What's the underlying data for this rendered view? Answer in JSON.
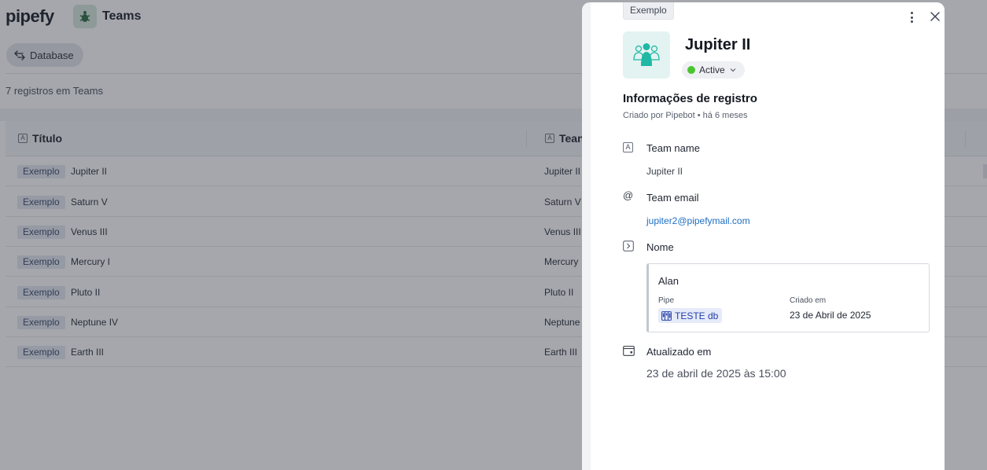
{
  "app": {
    "logo": "pipefy",
    "database_title": "Teams",
    "database_button_label": "Database",
    "records_count": "7 registros em Teams"
  },
  "table": {
    "columns": [
      "Título",
      "Tean"
    ],
    "rows": [
      {
        "tag": "Exemplo",
        "title": "Jupiter II",
        "team": "Jupiter II"
      },
      {
        "tag": "Exemplo",
        "title": "Saturn V",
        "team": "Saturn V"
      },
      {
        "tag": "Exemplo",
        "title": "Venus III",
        "team": "Venus III"
      },
      {
        "tag": "Exemplo",
        "title": "Mercury I",
        "team": "Mercury"
      },
      {
        "tag": "Exemplo",
        "title": "Pluto II",
        "team": "Pluto II"
      },
      {
        "tag": "Exemplo",
        "title": "Neptune IV",
        "team": "Neptune"
      },
      {
        "tag": "Exemplo",
        "title": "Earth III",
        "team": "Earth III"
      }
    ]
  },
  "panel": {
    "badge": "Exemplo",
    "title": "Jupiter II",
    "status": "Active",
    "status_color": "#49c530",
    "section_title": "Informações de registro",
    "section_subtitle": "Criado por Pipebot • há 6 meses",
    "fields": {
      "team_name": {
        "label": "Team name",
        "value": "Jupiter II",
        "icon": "text-field-icon"
      },
      "team_email": {
        "label": "Team email",
        "value": "jupiter2@pipefymail.com",
        "icon": "at-sign-icon"
      },
      "nome": {
        "label": "Nome",
        "icon": "connection-field-icon",
        "card": {
          "name": "Alan",
          "pipe_label": "Pipe",
          "pipe_value": "TESTE db",
          "created_label": "Criado em",
          "created_value": "23 de Abril de 2025"
        }
      },
      "updated": {
        "label": "Atualizado em",
        "value": "23 de abril de 2025 às 15:00",
        "icon": "calendar-icon"
      }
    }
  },
  "colors": {
    "accent_teal": "#1fb8a4",
    "link_blue": "#1d6fc4",
    "pipe_chip_text": "#2440a6"
  }
}
